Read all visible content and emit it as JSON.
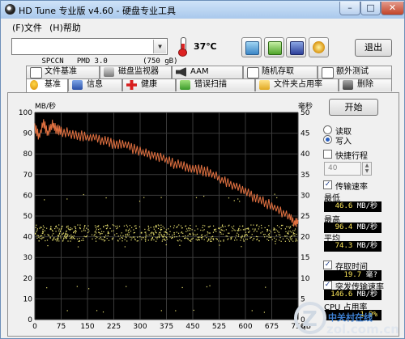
{
  "window": {
    "title": "HD Tune 专业版 v4.60 - 硬盘专业工具",
    "controls": {
      "minimize": "–",
      "maximize": "□",
      "close": "✕"
    }
  },
  "menu": {
    "items": [
      "(F)文件",
      "(H)帮助"
    ]
  },
  "toolbar": {
    "drive": "SPCCN   PMD 3.0        (750 gB)",
    "temperature": "37℃",
    "exit_label": "退出",
    "icons": [
      "copy-text-icon",
      "copy-screen-icon",
      "save-icon",
      "options-icon"
    ]
  },
  "tabs_row1": [
    {
      "label": "文件基准",
      "icon": "file-benchmark-icon"
    },
    {
      "label": "磁盘监视器",
      "icon": "disk-monitor-icon"
    },
    {
      "label": "AAM",
      "icon": "aam-speaker-icon"
    },
    {
      "label": "随机存取",
      "icon": "random-access-icon"
    },
    {
      "label": "额外测试",
      "icon": "extra-tests-icon"
    }
  ],
  "tabs_row2": [
    {
      "label": "基准",
      "icon": "benchmark-icon",
      "active": true
    },
    {
      "label": "信息",
      "icon": "info-icon",
      "active": false
    },
    {
      "label": "健康",
      "icon": "health-cross-icon",
      "active": false
    },
    {
      "label": "错误扫描",
      "icon": "error-scan-icon",
      "active": false
    },
    {
      "label": "文件夹占用率",
      "icon": "folder-usage-icon",
      "active": false
    },
    {
      "label": "删除",
      "icon": "erase-icon",
      "active": false
    }
  ],
  "side": {
    "start_label": "开始",
    "mode_read": "读取",
    "mode_write": "写入",
    "mode_selected": "write",
    "short_stroke_label": "快捷行程",
    "short_stroke_checked": false,
    "short_stroke_value": "40",
    "transfer_rate_label": "传输速率",
    "transfer_rate_checked": true,
    "min_label": "最低",
    "min_value": "46.6",
    "max_label": "最高",
    "max_value": "96.4",
    "avg_label": "平均",
    "avg_value": "74.3",
    "rate_unit": "MB/秒",
    "access_time_label": "存取时间",
    "access_time_checked": true,
    "access_time_value": "19.7",
    "access_time_unit": "毫?",
    "burst_rate_label": "突发传输速率",
    "burst_rate_checked": true,
    "burst_rate_value": "146.6",
    "burst_rate_unit": "MB/秒",
    "cpu_label": "CPU 占用率",
    "cpu_value": "1.9%"
  },
  "watermark": {
    "brand": "zol.com.cn",
    "sub": "中关村在线"
  },
  "colors": {
    "transfer_line": "#e07040",
    "access_points": "#e8e070",
    "grid": "#3a3a3a",
    "plot_bg": "#000000"
  },
  "chart_data": {
    "type": "line",
    "y_left_label": "MB/秒",
    "y_right_label": "毫秒",
    "ylim_left": [
      0,
      100
    ],
    "ylim_right": [
      0,
      50
    ],
    "xlim": [
      0,
      750
    ],
    "x_ticks": [
      0,
      75,
      150,
      225,
      300,
      375,
      450,
      525,
      600,
      675,
      750
    ],
    "y_left_ticks": [
      0,
      10,
      20,
      30,
      40,
      50,
      60,
      70,
      80,
      90,
      100
    ],
    "y_right_ticks": [
      0,
      5,
      10,
      15,
      20,
      25,
      30,
      35,
      40,
      45,
      50
    ],
    "x_unit": "gB",
    "grid": true,
    "series": [
      {
        "type": "line",
        "axis": "left",
        "x": [
          0,
          12,
          25,
          37,
          50,
          62,
          75,
          100,
          125,
          150,
          175,
          200,
          225,
          250,
          275,
          300,
          325,
          350,
          375,
          400,
          425,
          450,
          475,
          500,
          525,
          550,
          575,
          600,
          625,
          650,
          675,
          700,
          725,
          740,
          750
        ],
        "values": [
          93,
          88,
          95,
          90,
          94,
          92,
          91,
          90,
          89,
          88,
          88,
          86,
          85,
          85,
          83,
          81,
          80,
          79,
          77,
          75,
          74,
          73,
          72,
          71,
          68,
          66,
          64,
          62,
          59,
          57,
          55,
          52,
          50,
          46.6,
          48
        ]
      },
      {
        "type": "scatter",
        "axis": "right",
        "band_center_ms": 21,
        "band_spread_ms": 2,
        "outlier_ms": [
          29,
          30,
          18,
          2,
          8
        ],
        "point_count": 700
      }
    ]
  }
}
